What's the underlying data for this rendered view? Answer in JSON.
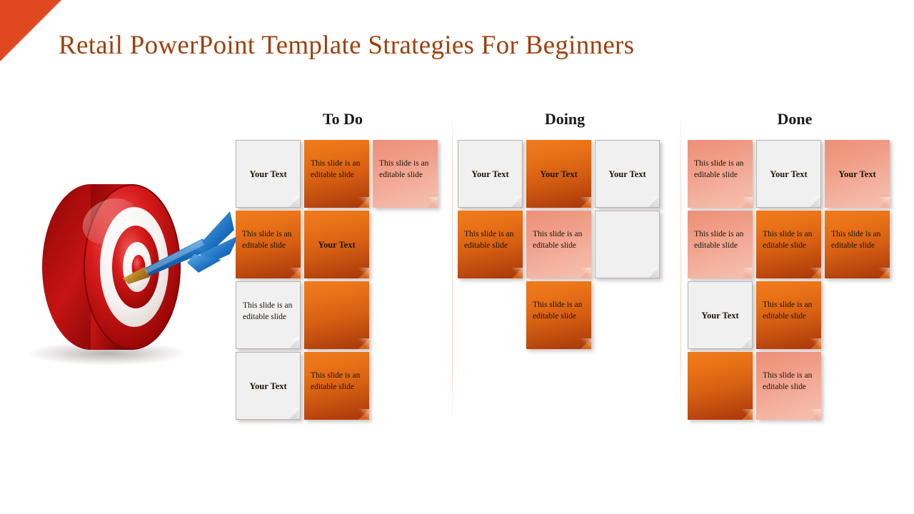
{
  "slide": {
    "title": "Retail PowerPoint Template Strategies For Beginners",
    "accent_color": "#e0481f",
    "title_color": "#9e400d"
  },
  "decor": {
    "corner_triangle": "corner-triangle",
    "illustration": "dartboard-with-dart"
  },
  "note_text": {
    "editable": "This slide is an editable slide",
    "your_text": "Your Text",
    "blank": ""
  },
  "columns": [
    {
      "id": "todo",
      "title": "To Do",
      "rows": [
        [
          {
            "color": "white",
            "kind": "title",
            "text": "Your Text"
          },
          {
            "color": "orange",
            "kind": "para",
            "text": "This slide is an editable slide"
          },
          {
            "color": "pink",
            "kind": "para",
            "text": "This slide is an editable slide"
          }
        ],
        [
          {
            "color": "orange",
            "kind": "para",
            "text": "This slide is an editable slide"
          },
          {
            "color": "orange",
            "kind": "title",
            "text": "Your Text"
          },
          {
            "color": "empty",
            "kind": "none",
            "text": ""
          }
        ],
        [
          {
            "color": "white",
            "kind": "para",
            "text": "This slide is an editable slide"
          },
          {
            "color": "orange",
            "kind": "none",
            "text": ""
          },
          {
            "color": "empty",
            "kind": "none",
            "text": ""
          }
        ],
        [
          {
            "color": "white",
            "kind": "title",
            "text": "Your Text"
          },
          {
            "color": "orange",
            "kind": "para",
            "text": "This slide is an editable slide"
          },
          {
            "color": "empty",
            "kind": "none",
            "text": ""
          }
        ]
      ]
    },
    {
      "id": "doing",
      "title": "Doing",
      "rows": [
        [
          {
            "color": "white",
            "kind": "title",
            "text": "Your Text"
          },
          {
            "color": "orange",
            "kind": "title",
            "text": "Your Text"
          },
          {
            "color": "white",
            "kind": "title",
            "text": "Your Text"
          }
        ],
        [
          {
            "color": "orange",
            "kind": "para",
            "text": "This slide is an editable slide"
          },
          {
            "color": "pink",
            "kind": "para",
            "text": "This slide is an editable slide"
          },
          {
            "color": "white",
            "kind": "none",
            "text": ""
          }
        ],
        [
          {
            "color": "empty",
            "kind": "none",
            "text": ""
          },
          {
            "color": "orange",
            "kind": "para",
            "text": "This slide is an editable slide"
          },
          {
            "color": "empty",
            "kind": "none",
            "text": ""
          }
        ]
      ]
    },
    {
      "id": "done",
      "title": "Done",
      "rows": [
        [
          {
            "color": "pink",
            "kind": "para",
            "text": "This slide is an editable slide"
          },
          {
            "color": "white",
            "kind": "title",
            "text": "Your Text"
          },
          {
            "color": "pink",
            "kind": "title",
            "text": "Your Text"
          }
        ],
        [
          {
            "color": "pink",
            "kind": "para",
            "text": "This slide is an editable slide"
          },
          {
            "color": "orange",
            "kind": "para",
            "text": "This slide is an editable slide"
          },
          {
            "color": "orange",
            "kind": "para",
            "text": "This slide is an editable slide"
          }
        ],
        [
          {
            "color": "white",
            "kind": "title",
            "text": "Your Text"
          },
          {
            "color": "orange",
            "kind": "para",
            "text": "This slide is an editable slide"
          },
          {
            "color": "empty",
            "kind": "none",
            "text": ""
          }
        ],
        [
          {
            "color": "orange",
            "kind": "none",
            "text": ""
          },
          {
            "color": "pink",
            "kind": "para",
            "text": "This slide is an editable slide"
          },
          {
            "color": "empty",
            "kind": "none",
            "text": ""
          }
        ]
      ]
    }
  ]
}
